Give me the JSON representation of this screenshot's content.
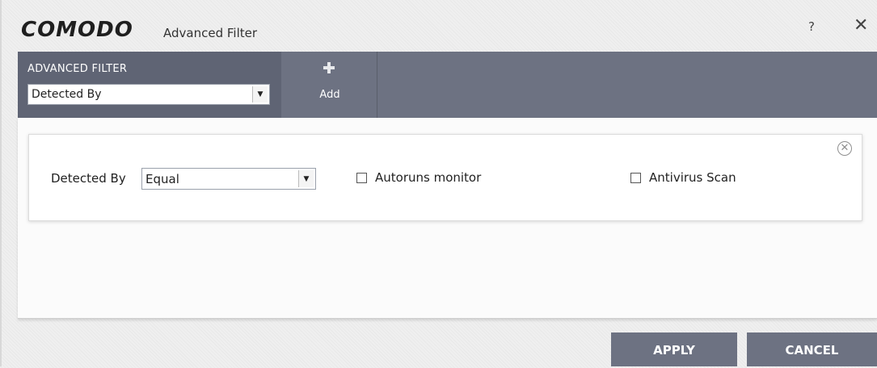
{
  "window": {
    "logo": "COMODO",
    "title": "Advanced Filter",
    "help_label": "?",
    "close_label": "✕"
  },
  "toolbar": {
    "section_label": "ADVANCED FILTER",
    "filter_select": {
      "selected": "Detected By"
    },
    "add_label": "Add"
  },
  "filter_row": {
    "label": "Detected By",
    "condition": {
      "selected": "Equal"
    },
    "options": [
      {
        "label": "Autoruns monitor",
        "checked": false
      },
      {
        "label": "Antivirus Scan",
        "checked": false
      }
    ],
    "remove_icon": "close-circle-icon"
  },
  "actions": {
    "apply_label": "APPLY",
    "cancel_label": "CANCEL"
  }
}
